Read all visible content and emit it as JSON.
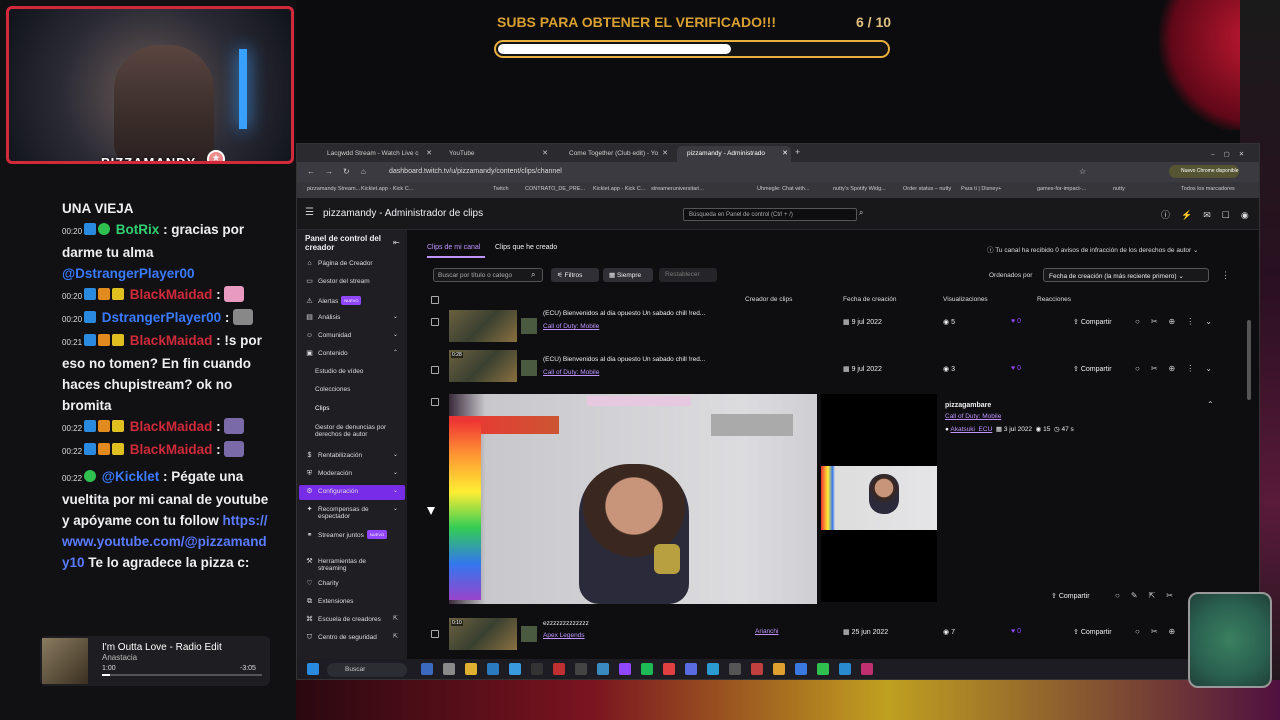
{
  "overlay": {
    "streamer_name": "PIZZAMANDY",
    "goal_text": "SUBS PARA OBTENER EL VERIFICADO!!!",
    "goal_count": "6 / 10",
    "goal_progress": 0.6
  },
  "chat": [
    {
      "text": "UNA VIEJA"
    },
    {
      "time": "00:20",
      "user": "BotRix",
      "msg": ": gracias por darme tu alma",
      "mention": "@DstrangerPlayer00"
    },
    {
      "time": "00:20",
      "user": "BlackMaidad",
      "msg": ":"
    },
    {
      "time": "00:20",
      "user": "DstrangerPlayer00",
      "msg": ":"
    },
    {
      "time": "00:21",
      "user": "BlackMaidad",
      "msg": ": !s por eso no tomen? En fin cuando haces chupistream? ok no bromita"
    },
    {
      "time": "00:22",
      "user": "BlackMaidad",
      "msg": ":"
    },
    {
      "time": "00:22",
      "user": "BlackMaidad",
      "msg": ":"
    },
    {
      "time": "00:22",
      "user": "@Kicklet",
      "msg": ": Pégate una vueltita por mi canal de youtube y apóyame con tu follow",
      "link": "https://www.youtube.com/@pizzamandy10",
      "after": "Te lo agradece la pizza c:"
    }
  ],
  "music": {
    "title": "I'm Outta Love - Radio Edit",
    "artist": "Anastacia",
    "elapsed": "1:00",
    "remaining": "-3:05",
    "progress": 0.05
  },
  "browser": {
    "tabs": [
      {
        "label": "Lacgwdd Stream - Watch Live c"
      },
      {
        "label": "YouTube"
      },
      {
        "label": "Come Together (Club edit) - Yo"
      },
      {
        "label": "pizzamandy - Administrado"
      }
    ],
    "url": "dashboard.twitch.tv/u/pizzamandy/content/clips/channel",
    "chrome_badge": "Nuevo Chrome disponible",
    "bookmarks": [
      "pizzamandy Stream...",
      "Kicklet.app - Kick C...",
      "Twitch",
      "CONTRATO_DE_PRE...",
      "Kicklet.app - Kick C...",
      "streameruniversitari...",
      "Uhmegle: Chat with...",
      "nutty's Spotify Widg...",
      "Order status – nutty",
      "Para ti | Disney+",
      "games-for-impact-...",
      "nutty",
      "Todos los marcadores"
    ]
  },
  "app": {
    "title": "pizzamandy - Administrador de clips",
    "search_placeholder": "Búsqueda en Panel de control (Ctrl + /)"
  },
  "sidebar": {
    "header": "Panel de control del creador",
    "items": [
      {
        "label": "Página de Creador",
        "icon": "home-icon"
      },
      {
        "label": "Gestor del stream",
        "icon": "stream-icon"
      },
      {
        "label": "Alertas",
        "icon": "alert-icon",
        "badge": "NUEVO"
      },
      {
        "label": "Análisis",
        "icon": "chart-icon"
      },
      {
        "label": "Comunidad",
        "icon": "community-icon"
      },
      {
        "label": "Contenido",
        "icon": "content-icon"
      },
      {
        "label": "Estudio de vídeo",
        "sub": true
      },
      {
        "label": "Colecciones",
        "sub": true
      },
      {
        "label": "Clips",
        "sub": true,
        "active": true
      },
      {
        "label": "Gestor de denuncias por derechos de autor",
        "sub": true
      },
      {
        "label": "Rentabilización",
        "icon": "money-icon"
      },
      {
        "label": "Moderación",
        "icon": "shield-icon"
      },
      {
        "label": "Configuración",
        "icon": "gear-icon"
      },
      {
        "label": "Recompensas de espectador",
        "icon": "reward-icon"
      },
      {
        "label": "Streamer juntos",
        "icon": "together-icon",
        "badge": "NUEVO"
      },
      {
        "label": "Herramientas de streaming",
        "icon": "tools-icon"
      },
      {
        "label": "Charity",
        "icon": "charity-icon"
      },
      {
        "label": "Extensiones",
        "icon": "extensions-icon"
      },
      {
        "label": "Escuela de creadores",
        "icon": "school-icon"
      },
      {
        "label": "Centro de seguridad",
        "icon": "security-icon"
      }
    ]
  },
  "content": {
    "tabs": [
      "Clips de mi canal",
      "Clips que he creado"
    ],
    "notice": "Tu canal ha recibido 0 avisos de infracción de los derechos de autor",
    "filter_placeholder": "Buscar por título o catego",
    "filters_label": "Filtros",
    "period_label": "Siempre",
    "reset_label": "Restablecer",
    "sort_label": "Ordenados por",
    "sort_value": "Fecha de creación (la más reciente primero)",
    "columns": [
      "Creador de clips",
      "Fecha de creación",
      "Visualizaciones",
      "Reacciones"
    ],
    "share_label": "Compartir",
    "rows": [
      {
        "title": "(ECU) Bienvenidos al dia opuesto Un sabado chill !red...",
        "game": "Call of Duty: Mobile",
        "creator": "",
        "date": "9 jul 2022",
        "views": "5",
        "reactions": "0"
      },
      {
        "title": "(ECU) Bienvenidos al dia opuesto Un sabado chill !red...",
        "game": "Call of Duty: Mobile",
        "creator": "",
        "date": "9 jul 2022",
        "views": "3",
        "reactions": "0",
        "duration": "0:28"
      },
      {
        "title": "ezzzzzzzzzzzzz",
        "game": "Apex Legends",
        "creator": "Arianchi",
        "date": "25 jun 2022",
        "views": "7",
        "reactions": "0",
        "duration": "0:10"
      }
    ],
    "expanded": {
      "name": "pizzagambare",
      "game": "Call of Duty: Mobile",
      "creator": "Akatsuki_ECU",
      "date": "3 jul 2022",
      "views": "15",
      "duration": "47 s"
    }
  },
  "taskbar": {
    "search_label": "Buscar"
  }
}
